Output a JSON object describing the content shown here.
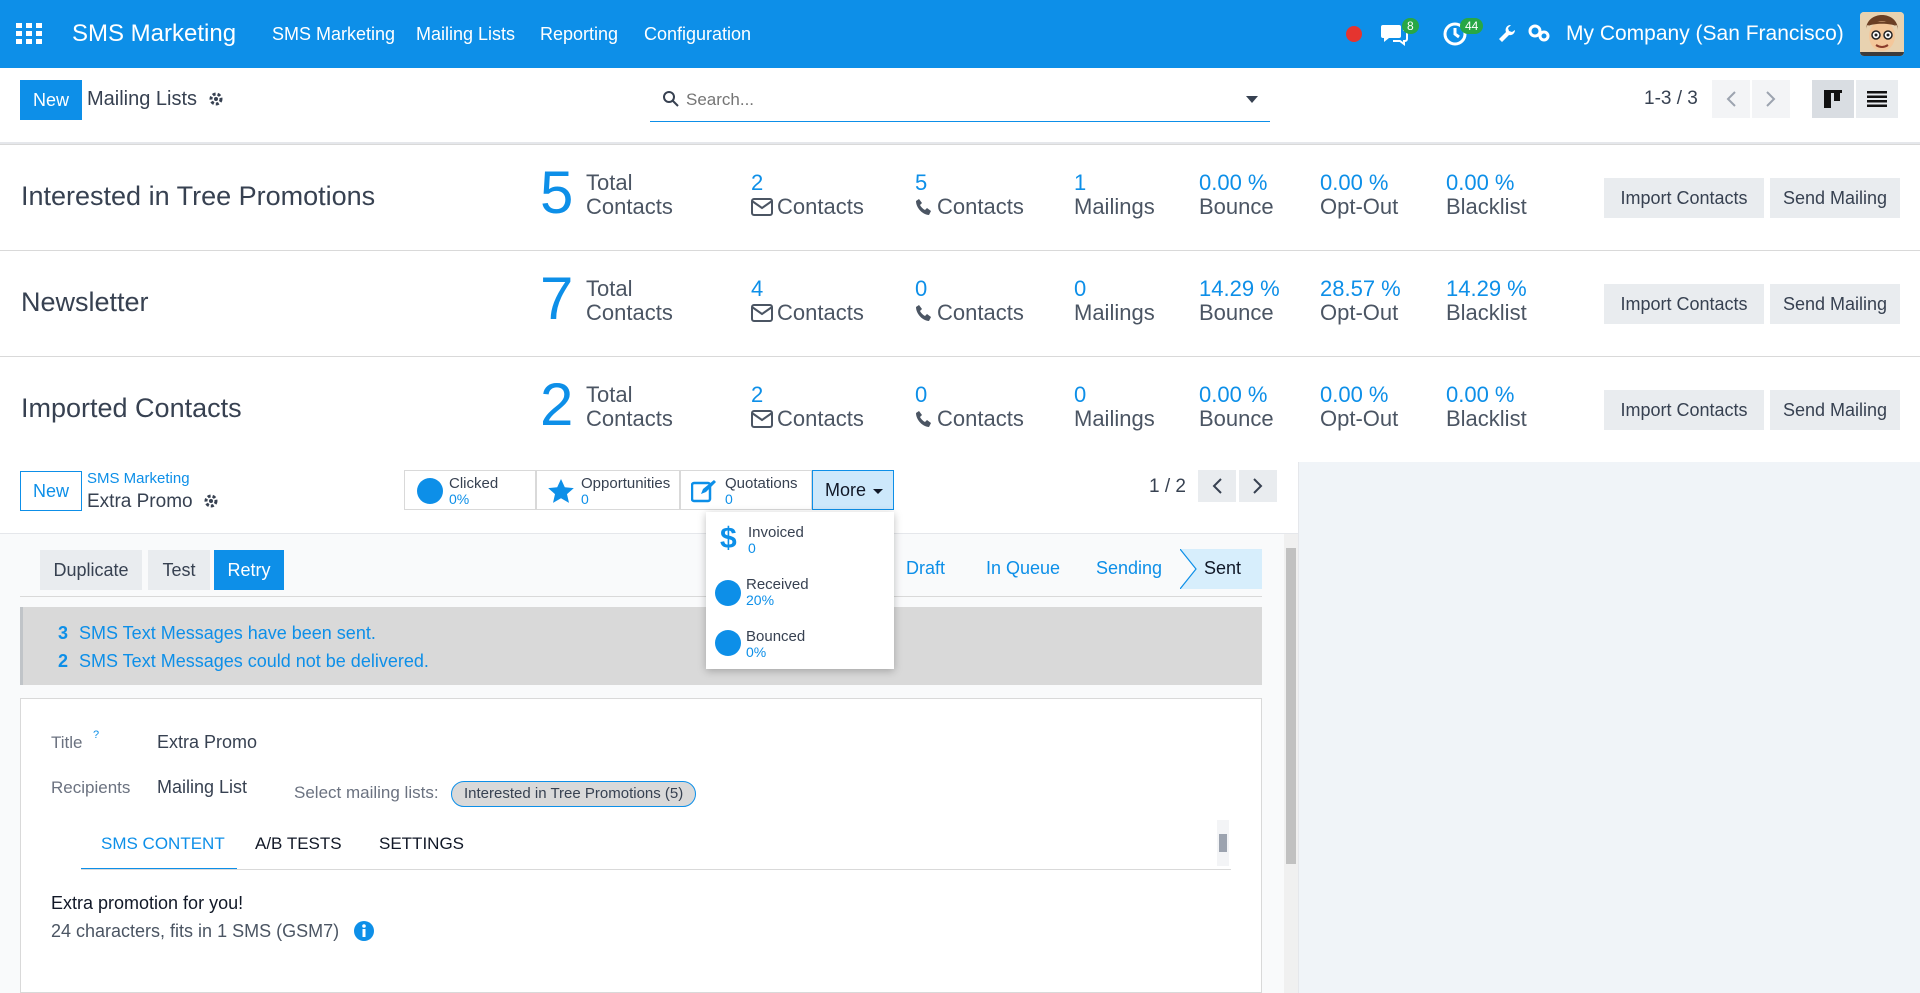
{
  "nav": {
    "brand": "SMS Marketing",
    "menu": [
      "SMS Marketing",
      "Mailing Lists",
      "Reporting",
      "Configuration"
    ],
    "messages_count": "8",
    "activities_count": "44",
    "company": "My Company (San Francisco)"
  },
  "control": {
    "new_label": "New",
    "title": "Mailing Lists",
    "search_placeholder": "Search...",
    "pager": "1-3 / 3"
  },
  "mailing_lists": [
    {
      "name": "Interested in Tree Promotions",
      "total": "5",
      "total_label1": "Total",
      "total_label2": "Contacts",
      "email_count": "2",
      "email_label": "Contacts",
      "phone_count": "5",
      "phone_label": "Contacts",
      "mailings": "1",
      "mailings_label": "Mailings",
      "bounce": "0.00 %",
      "bounce_label": "Bounce",
      "optout": "0.00 %",
      "optout_label": "Opt-Out",
      "blacklist": "0.00 %",
      "blacklist_label": "Blacklist"
    },
    {
      "name": "Newsletter",
      "total": "7",
      "total_label1": "Total",
      "total_label2": "Contacts",
      "email_count": "4",
      "email_label": "Contacts",
      "phone_count": "0",
      "phone_label": "Contacts",
      "mailings": "0",
      "mailings_label": "Mailings",
      "bounce": "14.29 %",
      "bounce_label": "Bounce",
      "optout": "28.57 %",
      "optout_label": "Opt-Out",
      "blacklist": "14.29 %",
      "blacklist_label": "Blacklist"
    },
    {
      "name": "Imported Contacts",
      "total": "2",
      "total_label1": "Total",
      "total_label2": "Contacts",
      "email_count": "2",
      "email_label": "Contacts",
      "phone_count": "0",
      "phone_label": "Contacts",
      "mailings": "0",
      "mailings_label": "Mailings",
      "bounce": "0.00 %",
      "bounce_label": "Bounce",
      "optout": "0.00 %",
      "optout_label": "Opt-Out",
      "blacklist": "0.00 %",
      "blacklist_label": "Blacklist"
    }
  ],
  "row_buttons": {
    "import": "Import Contacts",
    "send": "Send Mailing"
  },
  "form": {
    "new_label": "New",
    "breadcrumb": "SMS Marketing",
    "record": "Extra Promo",
    "pager": "1 / 2",
    "stats": [
      {
        "label": "Clicked",
        "value": "0%"
      },
      {
        "label": "Opportunities",
        "value": "0"
      },
      {
        "label": "Quotations",
        "value": "0"
      }
    ],
    "more_label": "More",
    "dropdown": [
      {
        "label": "Invoiced",
        "value": "0"
      },
      {
        "label": "Received",
        "value": "20%"
      },
      {
        "label": "Bounced",
        "value": "0%"
      }
    ],
    "actions": {
      "duplicate": "Duplicate",
      "test": "Test",
      "retry": "Retry"
    },
    "stages": [
      "Draft",
      "In Queue",
      "Sending",
      "Sent"
    ],
    "alert": {
      "sent_count": "3",
      "sent_text": "SMS Text Messages have been sent.",
      "failed_count": "2",
      "failed_text": "SMS Text Messages could not be delivered."
    },
    "title_label": "Title",
    "title_help": "?",
    "title_value": "Extra Promo",
    "recipients_label": "Recipients",
    "recipients_value": "Mailing List",
    "select_lists_label": "Select mailing lists:",
    "selected_list_tag": "Interested in Tree Promotions (5)",
    "tabs": [
      "SMS CONTENT",
      "A/B TESTS",
      "SETTINGS"
    ],
    "sms_body": "Extra promotion for you!",
    "sms_info": "24 characters, fits in 1 SMS (GSM7)"
  }
}
